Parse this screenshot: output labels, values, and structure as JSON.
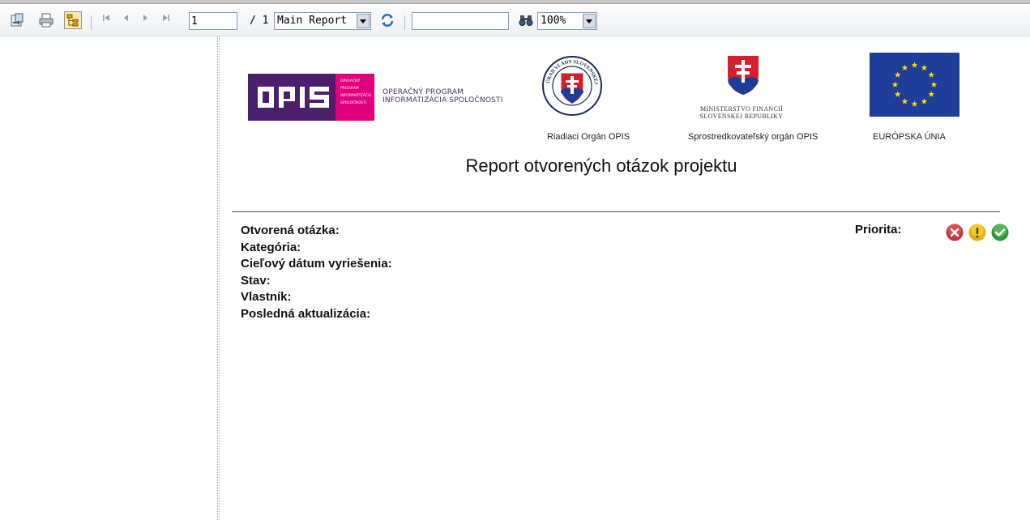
{
  "toolbar": {
    "page_current": "1",
    "page_total": "/ 1",
    "report_select": "Main Report",
    "search_value": "",
    "zoom_select": "100%"
  },
  "report": {
    "opis_logo_text": "OPIS",
    "opis_logo_small": [
      "OPERAČNÝ",
      "PROGRAM",
      "INFORMATIZÁCIA",
      "SPOLOČNOSTI"
    ],
    "opis_caption_line1": "OPERAČNÝ PROGRAM",
    "opis_caption_line2": "INFORMATIZÁCIA SPOLOČNOSTI",
    "crest_ring_text": "ÚRAD VLÁDY SLOVENSKEJ REPUBLIKY",
    "ministry_line1": "MINISTERSTVO FINANCIÍ",
    "ministry_line2": "SLOVENSKEJ REPUBLIKY",
    "caption_riadiaci": "Riadiaci Orgán OPIS",
    "caption_sprostredkovatelsky": "Sprostredkovateľský orgán OPIS",
    "caption_eu": "EURÓPSKA ÚNIA",
    "title": "Report otvorených otázok projektu",
    "fields": {
      "open_question": "Otvorená otázka:",
      "category": "Kategória:",
      "target_date": "Cieľový dátum vyriešenia:",
      "status": "Stav:",
      "owner": "Vlastník:",
      "last_update": "Posledná aktualizácia:"
    },
    "priority_label": "Priorita:"
  },
  "colors": {
    "opis_purple": "#4b1f6b",
    "opis_pink": "#e4007d",
    "eu_blue": "#1f3d9a",
    "eu_star": "#ffdd00",
    "priority_high": "#c9323a",
    "priority_medium": "#e0b400",
    "priority_low": "#2e9a3a"
  }
}
